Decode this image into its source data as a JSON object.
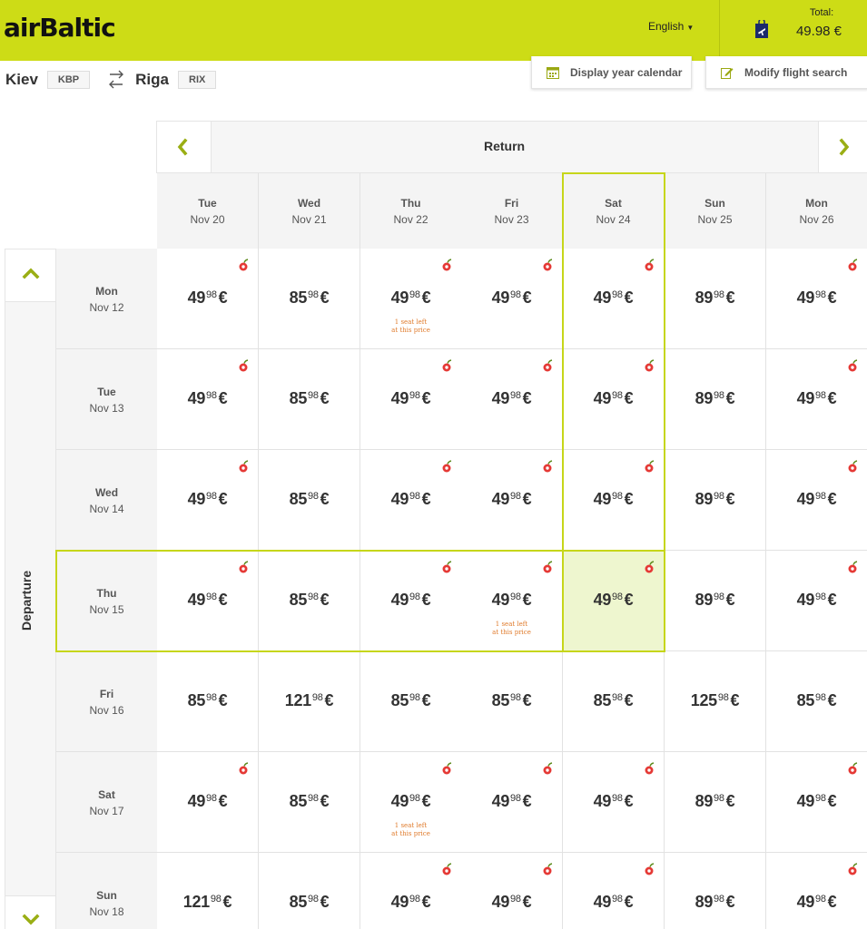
{
  "header": {
    "logo": "airBaltic",
    "language": "English",
    "total_label": "Total:",
    "total_value": "49.98 €"
  },
  "route": {
    "from_city": "Kiev",
    "from_code": "KBP",
    "to_city": "Riga",
    "to_code": "RIX"
  },
  "toolbar": {
    "year_calendar": "Display year calendar",
    "modify_search": "Modify flight search"
  },
  "grid": {
    "return_label": "Return",
    "departure_label": "Departure",
    "return_dates": [
      {
        "day": "Tue",
        "date": "Nov 20"
      },
      {
        "day": "Wed",
        "date": "Nov 21"
      },
      {
        "day": "Thu",
        "date": "Nov 22"
      },
      {
        "day": "Fri",
        "date": "Nov 23"
      },
      {
        "day": "Sat",
        "date": "Nov 24"
      },
      {
        "day": "Sun",
        "date": "Nov 25"
      },
      {
        "day": "Mon",
        "date": "Nov 26"
      }
    ],
    "departure_dates": [
      {
        "day": "Mon",
        "date": "Nov 12"
      },
      {
        "day": "Tue",
        "date": "Nov 13"
      },
      {
        "day": "Wed",
        "date": "Nov 14"
      },
      {
        "day": "Thu",
        "date": "Nov 15"
      },
      {
        "day": "Fri",
        "date": "Nov 16"
      },
      {
        "day": "Sat",
        "date": "Nov 17"
      },
      {
        "day": "Sun",
        "date": "Nov 18"
      }
    ],
    "seat_notice_line1": "1 seat left",
    "seat_notice_line2": "at this price",
    "currency": "€",
    "selected": {
      "departure": "Nov 15",
      "return": "Nov 24"
    },
    "rows": [
      [
        {
          "w": "49",
          "c": "98",
          "b": true
        },
        {
          "w": "85",
          "c": "98",
          "b": false
        },
        {
          "w": "49",
          "c": "98",
          "b": true,
          "s": true
        },
        {
          "w": "49",
          "c": "98",
          "b": true
        },
        {
          "w": "49",
          "c": "98",
          "b": true
        },
        {
          "w": "89",
          "c": "98",
          "b": false
        },
        {
          "w": "49",
          "c": "98",
          "b": true
        }
      ],
      [
        {
          "w": "49",
          "c": "98",
          "b": true
        },
        {
          "w": "85",
          "c": "98",
          "b": false
        },
        {
          "w": "49",
          "c": "98",
          "b": true
        },
        {
          "w": "49",
          "c": "98",
          "b": true
        },
        {
          "w": "49",
          "c": "98",
          "b": true
        },
        {
          "w": "89",
          "c": "98",
          "b": false
        },
        {
          "w": "49",
          "c": "98",
          "b": true
        }
      ],
      [
        {
          "w": "49",
          "c": "98",
          "b": true
        },
        {
          "w": "85",
          "c": "98",
          "b": false
        },
        {
          "w": "49",
          "c": "98",
          "b": true
        },
        {
          "w": "49",
          "c": "98",
          "b": true
        },
        {
          "w": "49",
          "c": "98",
          "b": true
        },
        {
          "w": "89",
          "c": "98",
          "b": false
        },
        {
          "w": "49",
          "c": "98",
          "b": true
        }
      ],
      [
        {
          "w": "49",
          "c": "98",
          "b": true
        },
        {
          "w": "85",
          "c": "98",
          "b": false
        },
        {
          "w": "49",
          "c": "98",
          "b": true
        },
        {
          "w": "49",
          "c": "98",
          "b": true,
          "s": true
        },
        {
          "w": "49",
          "c": "98",
          "b": true,
          "sel": true
        },
        {
          "w": "89",
          "c": "98",
          "b": false
        },
        {
          "w": "49",
          "c": "98",
          "b": true
        }
      ],
      [
        {
          "w": "85",
          "c": "98",
          "b": false
        },
        {
          "w": "121",
          "c": "98",
          "b": false
        },
        {
          "w": "85",
          "c": "98",
          "b": false
        },
        {
          "w": "85",
          "c": "98",
          "b": false
        },
        {
          "w": "85",
          "c": "98",
          "b": false
        },
        {
          "w": "125",
          "c": "98",
          "b": false
        },
        {
          "w": "85",
          "c": "98",
          "b": false
        }
      ],
      [
        {
          "w": "49",
          "c": "98",
          "b": true
        },
        {
          "w": "85",
          "c": "98",
          "b": false
        },
        {
          "w": "49",
          "c": "98",
          "b": true,
          "s": true
        },
        {
          "w": "49",
          "c": "98",
          "b": true
        },
        {
          "w": "49",
          "c": "98",
          "b": true
        },
        {
          "w": "89",
          "c": "98",
          "b": false
        },
        {
          "w": "49",
          "c": "98",
          "b": true
        }
      ],
      [
        {
          "w": "121",
          "c": "98",
          "b": false
        },
        {
          "w": "85",
          "c": "98",
          "b": false
        },
        {
          "w": "49",
          "c": "98",
          "b": true
        },
        {
          "w": "49",
          "c": "98",
          "b": true
        },
        {
          "w": "49",
          "c": "98",
          "b": true
        },
        {
          "w": "89",
          "c": "98",
          "b": false
        },
        {
          "w": "49",
          "c": "98",
          "b": true
        }
      ]
    ]
  },
  "colors": {
    "brand": "#cddc16",
    "highlight": "#c6d61a",
    "selected_cell": "#eef6cf",
    "badge": "#e53935",
    "seat_notice": "#e07b2c"
  },
  "icons": {
    "lang_caret": "chevron-down-icon",
    "cart": "shopping-bag-plane-icon",
    "swap": "plane-swap-icon",
    "year": "calendar-icon",
    "modify": "edit-icon",
    "prev": "chevron-left-icon",
    "next": "chevron-right-icon",
    "up": "chevron-up-icon",
    "down": "chevron-down-icon",
    "badge": "cherry-badge-icon"
  }
}
